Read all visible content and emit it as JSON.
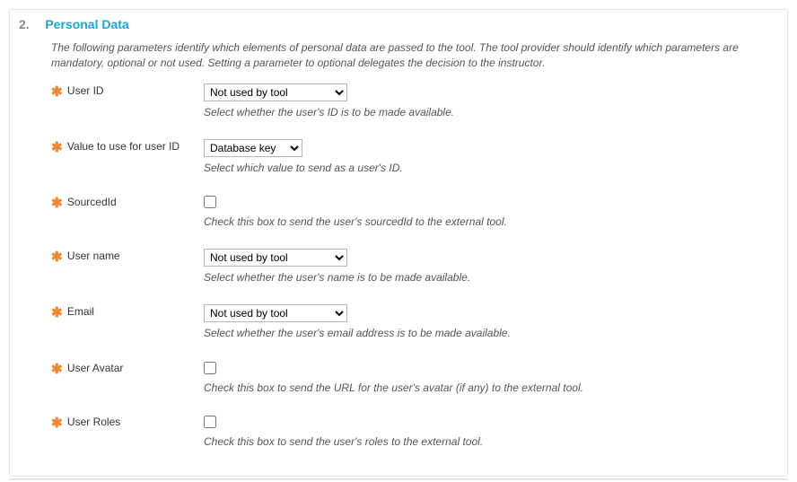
{
  "section": {
    "num": "2.",
    "title": "Personal Data",
    "description": "The following parameters identify which elements of personal data are passed to the tool. The tool provider should identify which parameters are mandatory, optional or not used. Setting a parameter to optional delegates the decision to the instructor."
  },
  "fields": {
    "user_id": {
      "label": "User ID",
      "value": "Not used by tool",
      "hint": "Select whether the user's ID is to be made available."
    },
    "id_value": {
      "label": "Value to use for user ID",
      "value": "Database key",
      "hint": "Select which value to send as a user's ID."
    },
    "sourcedid": {
      "label": "SourcedId",
      "hint": "Check this box to send the user's sourcedId to the external tool."
    },
    "user_name": {
      "label": "User name",
      "value": "Not used by tool",
      "hint": "Select whether the user's name is to be made available."
    },
    "email": {
      "label": "Email",
      "value": "Not used by tool",
      "hint": "Select whether the user's email address is to be made available."
    },
    "avatar": {
      "label": "User Avatar",
      "hint": "Check this box to send the URL for the user's avatar (if any) to the external tool."
    },
    "roles": {
      "label": "User Roles",
      "hint": "Check this box to send the user's roles to the external tool."
    }
  }
}
